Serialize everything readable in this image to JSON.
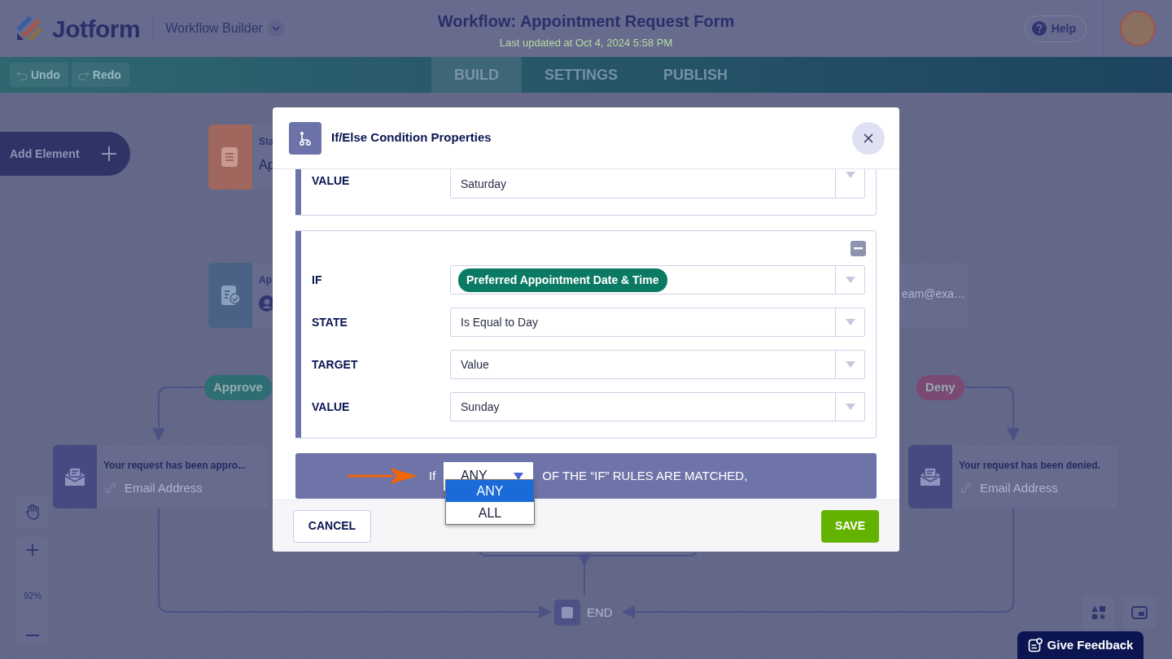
{
  "header": {
    "logo": "Jotform",
    "product": "Workflow Builder",
    "title": "Workflow: Appointment Request Form",
    "updated": "Last updated at Oct 4, 2024 5:58 PM",
    "help": "Help"
  },
  "toolbar": {
    "buttons": [
      {
        "kind": "undo",
        "label": "Undo",
        "disabled": true
      },
      {
        "kind": "redo",
        "label": "Redo",
        "disabled": true
      }
    ],
    "tabs": [
      {
        "label": "BUILD",
        "selected": true
      },
      {
        "label": "SETTINGS",
        "selected": false
      },
      {
        "label": "PUBLISH",
        "selected": false
      }
    ]
  },
  "canvas": {
    "add_element": "Add Element",
    "nodes": [
      {
        "kind": "form",
        "title": "Sta",
        "subtitle": "Ap"
      },
      {
        "kind": "approval",
        "title": "Ap",
        "assignee": "eam@exa…"
      }
    ],
    "branches": [
      {
        "label": "Approve",
        "color": "#2e6e73"
      },
      {
        "label": "Deny",
        "color": "#7a4a72"
      }
    ],
    "emails": [
      {
        "title": "Your request has been appro...",
        "recipient": "Email Address"
      },
      {
        "title": "Your request has been denied.",
        "recipient": "Email Address"
      }
    ],
    "end": "END",
    "zoom": "92%"
  },
  "feedback": "Give Feedback",
  "modal": {
    "title": "If/Else Condition Properties",
    "conditions": [
      {
        "removable": false,
        "fields": [
          {
            "kind": "select",
            "label": "VALUE",
            "value": "Saturday"
          }
        ]
      },
      {
        "removable": true,
        "fields": [
          {
            "kind": "tag",
            "label": "IF",
            "value": "Preferred Appointment Date & Time"
          },
          {
            "kind": "select",
            "label": "STATE",
            "value": "Is Equal to Day"
          },
          {
            "kind": "select",
            "label": "TARGET",
            "value": "Value"
          },
          {
            "kind": "select",
            "label": "VALUE",
            "value": "Sunday"
          }
        ]
      }
    ],
    "match": {
      "prefix": "If",
      "value": "ANY",
      "suffix": "OF THE “IF” RULES ARE MATCHED,",
      "expanded": true,
      "options": [
        {
          "label": "ANY",
          "selected": true
        },
        {
          "label": "ALL",
          "selected": false
        }
      ]
    },
    "cancel": "CANCEL",
    "save": "SAVE"
  }
}
